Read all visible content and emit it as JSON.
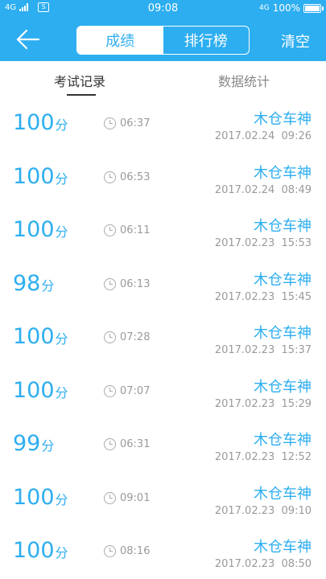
{
  "status_bar": {
    "signal_label": "4G",
    "sim_label": "S",
    "time": "09:08",
    "network": "4G",
    "battery": "100%"
  },
  "header": {
    "back_icon": "arrow-left-icon",
    "segments": [
      "成绩",
      "排行榜"
    ],
    "active_segment": 0,
    "clear_label": "清空"
  },
  "tabs": {
    "records_label": "考试记录",
    "stats_label": "数据统计"
  },
  "records": [
    {
      "score": "100",
      "unit": "分",
      "duration": "06:37",
      "name": "木仓车神",
      "datetime": "2017.02.24  09:26"
    },
    {
      "score": "100",
      "unit": "分",
      "duration": "06:53",
      "name": "木仓车神",
      "datetime": "2017.02.24  08:49"
    },
    {
      "score": "100",
      "unit": "分",
      "duration": "06:11",
      "name": "木仓车神",
      "datetime": "2017.02.23  15:53"
    },
    {
      "score": "98",
      "unit": "分",
      "duration": "06:13",
      "name": "木仓车神",
      "datetime": "2017.02.23  15:45"
    },
    {
      "score": "100",
      "unit": "分",
      "duration": "07:28",
      "name": "木仓车神",
      "datetime": "2017.02.23  15:37"
    },
    {
      "score": "100",
      "unit": "分",
      "duration": "07:07",
      "name": "木仓车神",
      "datetime": "2017.02.23  15:29"
    },
    {
      "score": "99",
      "unit": "分",
      "duration": "06:31",
      "name": "木仓车神",
      "datetime": "2017.02.23  12:52"
    },
    {
      "score": "100",
      "unit": "分",
      "duration": "09:01",
      "name": "木仓车神",
      "datetime": "2017.02.23  09:10"
    },
    {
      "score": "100",
      "unit": "分",
      "duration": "08:16",
      "name": "木仓车神",
      "datetime": "2017.02.23  08:50"
    }
  ],
  "colors": {
    "accent": "#2daef0",
    "muted": "#9a9a9a"
  }
}
